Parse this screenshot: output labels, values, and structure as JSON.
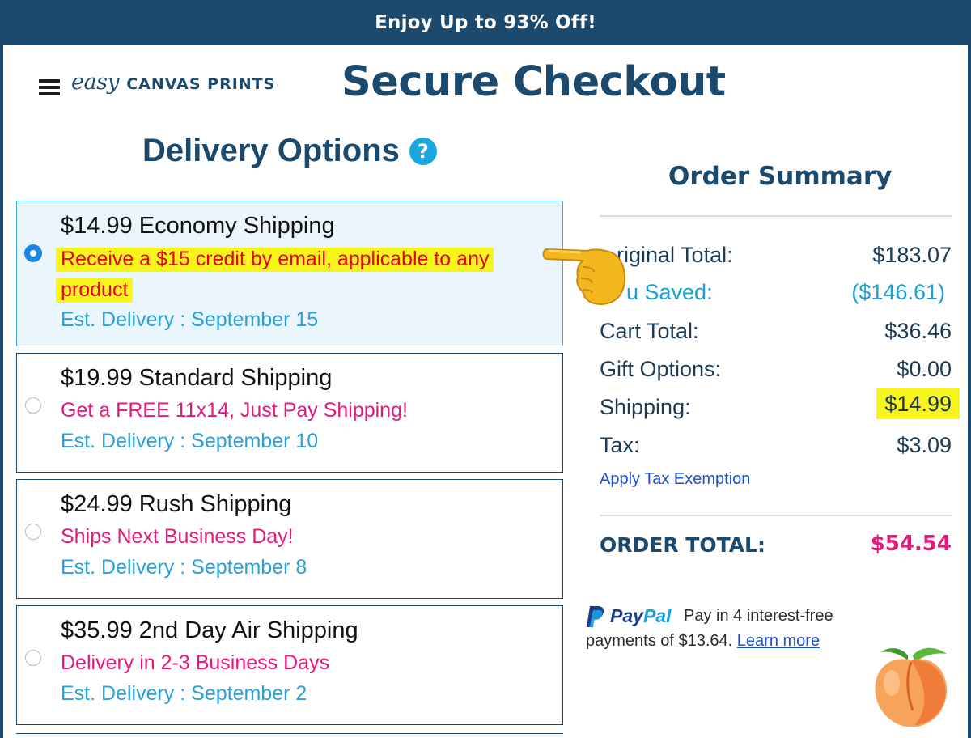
{
  "banner": {
    "text": "Enjoy Up to 93% Off!"
  },
  "header": {
    "logo_script": "easy",
    "logo_caps": "CANVAS PRINTS",
    "title": "Secure Checkout"
  },
  "delivery": {
    "heading": "Delivery Options",
    "help_icon": "?",
    "options": [
      {
        "title": "$14.99 Economy Shipping",
        "promo_line1": "Receive a $15 credit by email, applicable to any",
        "promo_line2": "product",
        "date": "Est. Delivery : September 15",
        "selected": true
      },
      {
        "title": "$19.99 Standard Shipping",
        "promo": "Get a FREE 11x14, Just Pay Shipping!",
        "date": "Est. Delivery : September 10",
        "selected": false
      },
      {
        "title": "$24.99 Rush Shipping",
        "promo": "Ships Next Business Day!",
        "date": "Est. Delivery : September 8",
        "selected": false
      },
      {
        "title": "$35.99 2nd Day Air Shipping",
        "promo": "Delivery in 2-3 Business Days",
        "date": "Est. Delivery : September 2",
        "selected": false
      }
    ]
  },
  "summary": {
    "title": "Order Summary",
    "original_total_label": "riginal Total:",
    "original_total_value": "$183.07",
    "saved_label": "u Saved:",
    "saved_value": "($146.61)",
    "cart_total_label": "Cart Total:",
    "cart_total_value": "$36.46",
    "gift_label": "Gift Options:",
    "gift_value": "$0.00",
    "shipping_label": "Shipping:",
    "shipping_value": "$14.99",
    "tax_label": "Tax:",
    "tax_value": "$3.09",
    "tax_exemption_link": "Apply Tax Exemption",
    "order_total_label": "ORDER TOTAL:",
    "order_total_value": "$54.54"
  },
  "paypal": {
    "brand_pay": "Pay",
    "brand_pal": "Pal",
    "text1": "Pay in 4 interest-free",
    "text2": "payments of $13.64.",
    "learn_more": "Learn more"
  },
  "colors": {
    "brand": "#1c4a6e",
    "pink": "#e6187e",
    "blue": "#2ba0d8",
    "highlight": "#f7f51c"
  },
  "icons": [
    "menu-icon",
    "help-icon",
    "pointing-hand-icon",
    "peach-icon",
    "paypal-icon"
  ]
}
